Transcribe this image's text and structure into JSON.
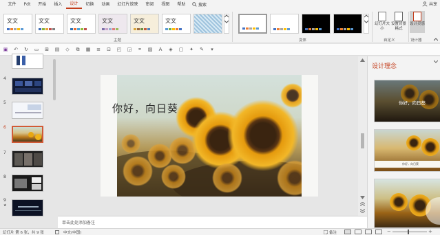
{
  "menubar": {
    "items": [
      {
        "label": "文件",
        "active": false
      },
      {
        "label": "Pdt",
        "active": false
      },
      {
        "label": "开始",
        "active": false
      },
      {
        "label": "插入",
        "active": false
      },
      {
        "label": "设计",
        "active": true
      },
      {
        "label": "切换",
        "active": false
      },
      {
        "label": "动画",
        "active": false
      },
      {
        "label": "幻灯片放映",
        "active": false
      },
      {
        "label": "审阅",
        "active": false
      },
      {
        "label": "视图",
        "active": false
      },
      {
        "label": "帮助",
        "active": false
      }
    ],
    "search_label": "搜索",
    "share_label": "共享"
  },
  "ribbon": {
    "themes": [
      {
        "text": "文文",
        "colors": [
          "#4472c4",
          "#ed7d31",
          "#a5a5a5",
          "#ffc000",
          "#5b9bd5"
        ]
      },
      {
        "text": "文文",
        "colors": [
          "#3e6db5",
          "#8bb43b",
          "#e9a137",
          "#c0504d",
          "#7f7f7f"
        ]
      },
      {
        "text": "文文",
        "colors": [
          "#2e75b6",
          "#e76a2e",
          "#4ba3d8",
          "#8fbc3b",
          "#c0504d"
        ]
      },
      {
        "text": "文文",
        "colors": [
          "#7b6da8",
          "#c8a2c8",
          "#96add2",
          "#e07b7b",
          "#9bbb59"
        ]
      },
      {
        "text": "文文",
        "colors": [
          "#d8a53a",
          "#9c6b3e",
          "#6c8e3e",
          "#c2583a",
          "#4f81bd"
        ]
      },
      {
        "text": "文文",
        "colors": [
          "#5b9bd5",
          "#70ad47",
          "#ffc000",
          "#ed7d31",
          "#4472c4"
        ]
      }
    ],
    "group_themes_label": "主题",
    "variants": [
      {
        "bg": "#ffffff",
        "colors": [
          "#4472c4",
          "#ed7d31",
          "#a5a5a5",
          "#ffc000",
          "#5b9bd5"
        ]
      },
      {
        "bg": "#ffffff",
        "colors": [
          "#4472c4",
          "#ed7d31",
          "#a5a5a5",
          "#ffc000",
          "#5b9bd5"
        ]
      },
      {
        "bg": "#000000",
        "colors": [
          "#4472c4",
          "#ed7d31",
          "#a5a5a5",
          "#ffc000",
          "#5b9bd5"
        ]
      },
      {
        "bg": "#000000",
        "colors": [
          "#4472c4",
          "#ed7d31",
          "#a5a5a5",
          "#ffc000",
          "#5b9bd5"
        ]
      }
    ],
    "group_variants_label": "变体",
    "slide_size_label": "幻灯片大小",
    "format_bg_label": "设置背景格式",
    "group_customize_label": "自定义",
    "designer_label": "设计灵感",
    "group_designer_label": "设计器"
  },
  "qat": {
    "icons": [
      "save-icon",
      "undo-icon",
      "redo-icon",
      "start-slideshow-icon",
      "new-slide-icon",
      "layout-icon",
      "shapes-icon",
      "arrange-icon",
      "quick-styles-icon",
      "align-icon",
      "group-icon",
      "bring-forward-icon",
      "send-backward-icon",
      "crop-icon",
      "picture-icon",
      "text-box-icon",
      "fill-icon",
      "outline-icon",
      "effects-icon",
      "format-painter-icon",
      "more-icon"
    ]
  },
  "thumbnails": [
    {
      "num": "4",
      "star": ""
    },
    {
      "num": "5",
      "star": ""
    },
    {
      "num": "6",
      "star": ""
    },
    {
      "num": "7",
      "star": ""
    },
    {
      "num": "8",
      "star": ""
    },
    {
      "num": "9",
      "star": "★"
    }
  ],
  "slide": {
    "title": "你好，向日葵"
  },
  "notes": {
    "placeholder": "单击此处添加备注"
  },
  "design_pane": {
    "title": "设计理念",
    "idea1_title": "你好，向日葵",
    "idea2_caption": "你好，向日葵"
  },
  "status": {
    "slide_info": "幻灯片 第 6 张，共 9 张",
    "language": "中文(中国)",
    "notes_label": "备注",
    "zoom": ""
  }
}
